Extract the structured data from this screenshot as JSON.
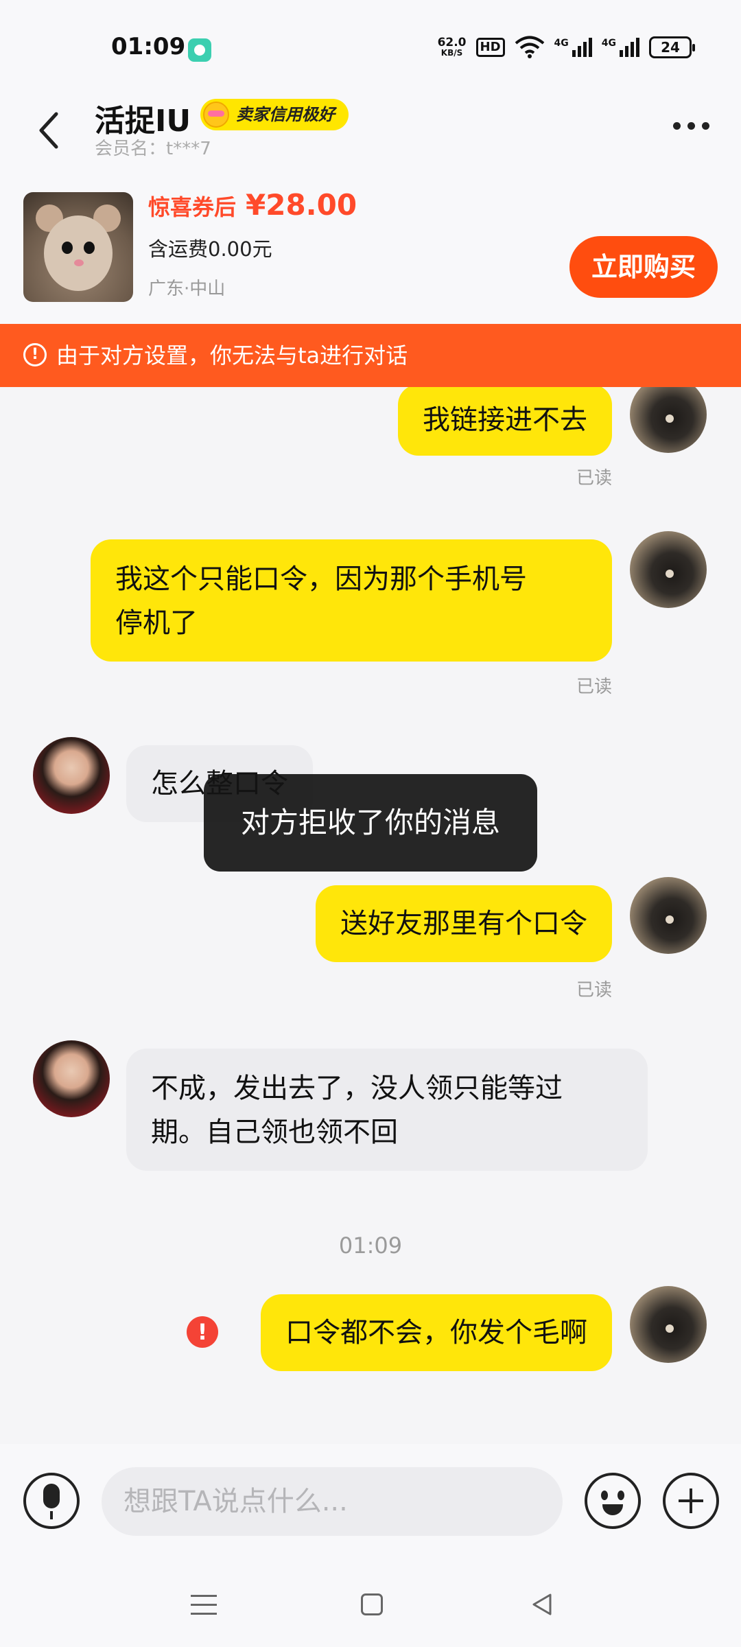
{
  "status_bar": {
    "time": "01:09",
    "net_speed_value": "62.0",
    "net_speed_unit": "KB/S",
    "hd_label": "HD",
    "signal_label_1": "4G",
    "signal_label_2": "4G",
    "battery": "24"
  },
  "header": {
    "title": "活捉IU",
    "credit_badge": "卖家信用极好",
    "member_label": "会员名：t***7",
    "icons": [
      "back-icon",
      "more-icon"
    ]
  },
  "product": {
    "coupon_label": "惊喜券后",
    "price": "¥28.00",
    "shipping": "含运费0.00元",
    "location": "广东·中山",
    "buy_button": "立即购买"
  },
  "banner": {
    "icon": "warning-icon",
    "text": "由于对方设置，你无法与ta进行对话"
  },
  "messages": [
    {
      "from": "me",
      "lines": [
        "我链接进不去"
      ],
      "status": "已读"
    },
    {
      "from": "me",
      "lines": [
        "我这个只能口令，因为那个手机号",
        "停机了"
      ],
      "status": "已读"
    },
    {
      "from": "other",
      "lines": [
        "怎么整口令"
      ]
    },
    {
      "from": "me",
      "lines": [
        "送好友那里有个口令"
      ],
      "status": "已读"
    },
    {
      "from": "other",
      "lines": [
        "不成，发出去了，没人领只能等过",
        "期。自己领也领不回"
      ]
    },
    {
      "time_separator": "01:09"
    },
    {
      "from": "me",
      "lines": [
        "口令都不会，你发个毛啊"
      ],
      "error": "!"
    }
  ],
  "toast": "对方拒收了你的消息",
  "input_bar": {
    "placeholder": "想跟TA说点什么...",
    "icons": [
      "voice-icon",
      "emoji-icon",
      "plus-icon"
    ]
  },
  "colors": {
    "accent_orange": "#ff4d0f",
    "banner": "#ff5a1f",
    "price": "#ff4a2a",
    "my_bubble": "#ffe60a",
    "other_bubble": "#ececef",
    "error": "#f44336"
  }
}
